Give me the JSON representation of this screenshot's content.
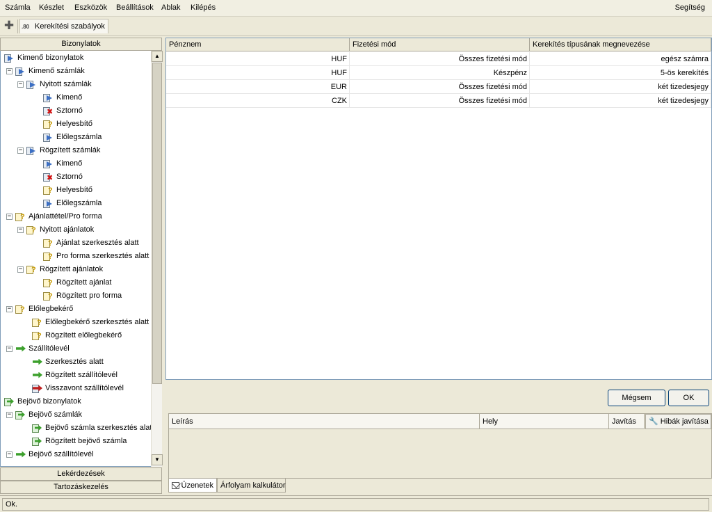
{
  "menu": {
    "items": [
      "Számla",
      "Készlet",
      "Eszközök",
      "Beállítások",
      "Ablak",
      "Kilépés"
    ],
    "help": "Segítség"
  },
  "toolbar": {
    "add_icon": "plus-icon",
    "tab_icon_text": ".80",
    "tab_label": "Kerekítési szabályok"
  },
  "left_panel": {
    "header": "Bizonylatok",
    "tree": [
      {
        "label": "Kimenő bizonylatok",
        "level": 0,
        "icon": "doc-arrow",
        "expander": ""
      },
      {
        "label": "Kimenő számlák",
        "level": 1,
        "icon": "doc-arrow",
        "expander": "−"
      },
      {
        "label": "Nyitott számlák",
        "level": 2,
        "icon": "doc-arrow",
        "expander": "−"
      },
      {
        "label": "Kimenő",
        "level": 3,
        "icon": "doc-arrow",
        "expander": ""
      },
      {
        "label": "Sztornó",
        "level": 3,
        "icon": "doc-x",
        "expander": ""
      },
      {
        "label": "Helyesbítő",
        "level": 3,
        "icon": "doc-question",
        "expander": ""
      },
      {
        "label": "Előlegszámla",
        "level": 3,
        "icon": "doc-arrow",
        "expander": ""
      },
      {
        "label": "Rögzített számlák",
        "level": 2,
        "icon": "doc-arrow",
        "expander": "−"
      },
      {
        "label": "Kimenő",
        "level": 3,
        "icon": "doc-arrow",
        "expander": ""
      },
      {
        "label": "Sztornó",
        "level": 3,
        "icon": "doc-x",
        "expander": ""
      },
      {
        "label": "Helyesbítő",
        "level": 3,
        "icon": "doc-question",
        "expander": ""
      },
      {
        "label": "Előlegszámla",
        "level": 3,
        "icon": "doc-arrow",
        "expander": ""
      },
      {
        "label": "Ajánlattétel/Pro forma",
        "level": 1,
        "icon": "doc-question",
        "expander": "−"
      },
      {
        "label": "Nyitott ajánlatok",
        "level": 2,
        "icon": "doc-question",
        "expander": "−"
      },
      {
        "label": "Ajánlat szerkesztés alatt",
        "level": 3,
        "icon": "doc-question",
        "expander": ""
      },
      {
        "label": "Pro forma szerkesztés alatt",
        "level": 3,
        "icon": "doc-question",
        "expander": ""
      },
      {
        "label": "Rögzített ajánlatok",
        "level": 2,
        "icon": "doc-question",
        "expander": "−"
      },
      {
        "label": "Rögzített ajánlat",
        "level": 3,
        "icon": "doc-question",
        "expander": ""
      },
      {
        "label": "Rögzített pro forma",
        "level": 3,
        "icon": "doc-question",
        "expander": ""
      },
      {
        "label": "Előlegbekérő",
        "level": 1,
        "icon": "doc-question",
        "expander": "−"
      },
      {
        "label": "Előlegbekérő szerkesztés alatt",
        "level": 2,
        "icon": "doc-question",
        "expander": ""
      },
      {
        "label": "Rögzített előlegbekérő",
        "level": 2,
        "icon": "doc-question",
        "expander": ""
      },
      {
        "label": "Szállítólevél",
        "level": 1,
        "icon": "green-arrow",
        "expander": "−"
      },
      {
        "label": "Szerkesztés alatt",
        "level": 2,
        "icon": "green-arrow",
        "expander": ""
      },
      {
        "label": "Rögzített szállítólevél",
        "level": 2,
        "icon": "green-arrow",
        "expander": ""
      },
      {
        "label": "Visszavont szállítólevél",
        "level": 2,
        "icon": "red-arrow",
        "expander": ""
      },
      {
        "label": "Bejövő bizonylatok",
        "level": 0,
        "icon": "doc-green",
        "expander": ""
      },
      {
        "label": "Bejövő számlák",
        "level": 1,
        "icon": "doc-green",
        "expander": "−"
      },
      {
        "label": "Bejövő számla szerkesztés alatt",
        "level": 2,
        "icon": "doc-green",
        "expander": ""
      },
      {
        "label": "Rögzített bejövő számla",
        "level": 2,
        "icon": "doc-green",
        "expander": ""
      },
      {
        "label": "Bejövő szállítólevél",
        "level": 1,
        "icon": "green-arrow",
        "expander": "−"
      }
    ],
    "accordion": [
      "Lekérdezések",
      "Tartozáskezelés"
    ]
  },
  "grid": {
    "columns": [
      "Pénznem",
      "Fizetési mód",
      "Kerekítés típusának megnevezése"
    ],
    "rows": [
      [
        "HUF",
        "Összes fizetési mód",
        "egész számra"
      ],
      [
        "HUF",
        "Készpénz",
        "5-ös kerekítés"
      ],
      [
        "EUR",
        "Összes fizetési mód",
        "két tizedesjegy"
      ],
      [
        "CZK",
        "Összes fizetési mód",
        "két tizedesjegy"
      ]
    ]
  },
  "buttons": {
    "cancel": "Mégsem",
    "ok": "OK"
  },
  "errors": {
    "columns": [
      "Leírás",
      "Hely",
      "Javítás"
    ],
    "fix_button": "Hibák javítása"
  },
  "bottom_tabs": [
    "Üzenetek",
    "Árfolyam kalkulátor"
  ],
  "status": "Ok."
}
